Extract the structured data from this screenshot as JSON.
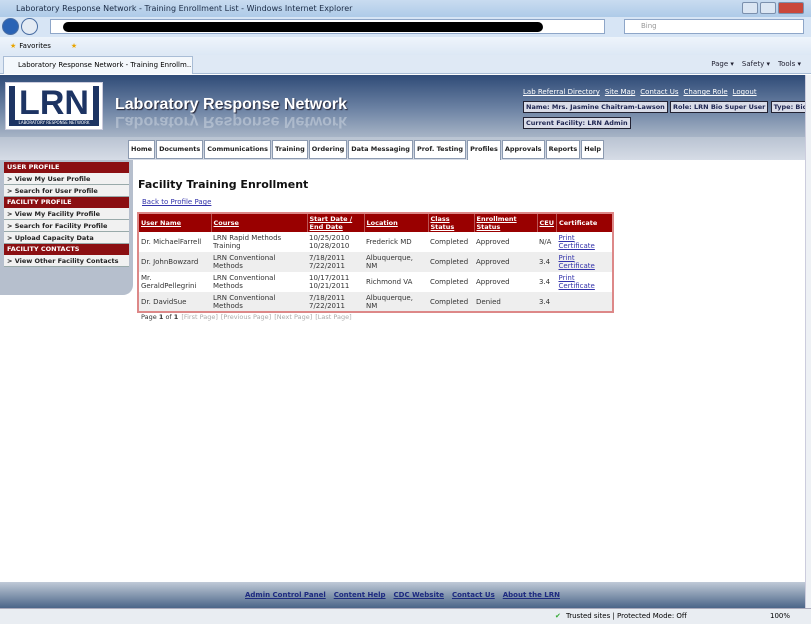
{
  "browser": {
    "window_title": "Laboratory Response Network - Training Enrollment List - Windows Internet Explorer",
    "search_placeholder": "Bing",
    "favorites_label": "Favorites",
    "tab_title": "Laboratory Response Network - Training Enrollm...",
    "commands": [
      "Page ▾",
      "Safety ▾",
      "Tools ▾"
    ],
    "status_text": "Trusted sites | Protected Mode: Off",
    "zoom": "100%"
  },
  "header": {
    "logo_text": "LRN",
    "logo_subtext": "LABORATORY RESPONSE NETWORK",
    "site_title": "Laboratory Response Network",
    "links": [
      "Lab Referral Directory",
      "Site Map",
      "Contact Us",
      "Change Role",
      "Logout"
    ],
    "name": "Name: Mrs. Jasmine Chaitram-Lawson",
    "role": "Role: LRN Bio Super User",
    "type": "Type: Bio",
    "facility": "Current Facility: LRN Admin"
  },
  "nav": [
    "Home",
    "Documents",
    "Communications",
    "Training",
    "Ordering",
    "Data Messaging",
    "Prof. Testing",
    "Profiles",
    "Approvals",
    "Reports",
    "Help"
  ],
  "sidebar": {
    "user_profile": "USER PROFILE",
    "view_user": "> View My User Profile",
    "search_user": "> Search for User Profile",
    "facility_profile": "FACILITY PROFILE",
    "view_facility": "> View My Facility Profile",
    "search_facility": "> Search for Facility Profile",
    "upload": "> Upload Capacity Data",
    "facility_contacts": "FACILITY CONTACTS",
    "view_contacts": "> View Other Facility Contacts"
  },
  "main": {
    "title": "Facility Training Enrollment",
    "back": "Back to Profile Page",
    "columns": [
      "User Name",
      "Course",
      "Start Date / End Date",
      "Location",
      "Class Status",
      "Enrollment Status",
      "CEU",
      "Certificate"
    ],
    "rows": [
      {
        "user": "Dr. MichaelFarrell",
        "course": "LRN Rapid Methods Training",
        "start": "10/25/2010",
        "end": "10/28/2010",
        "location": "Frederick MD",
        "class_status": "Completed",
        "enrollment": "Approved",
        "ceu": "N/A",
        "cert": "Print Certificate"
      },
      {
        "user": "Dr. JohnBowzard",
        "course": "LRN Conventional Methods",
        "start": "7/18/2011",
        "end": "7/22/2011",
        "location": "Albuquerque, NM",
        "class_status": "Completed",
        "enrollment": "Approved",
        "ceu": "3.4",
        "cert": "Print Certificate"
      },
      {
        "user": "Mr. GeraldPellegrini",
        "course": "LRN Conventional Methods",
        "start": "10/17/2011",
        "end": "10/21/2011",
        "location": "Richmond VA",
        "class_status": "Completed",
        "enrollment": "Approved",
        "ceu": "3.4",
        "cert": "Print Certificate"
      },
      {
        "user": "Dr. DavidSue",
        "course": "LRN Conventional Methods",
        "start": "7/18/2011",
        "end": "7/22/2011",
        "location": "Albuquerque, NM",
        "class_status": "Completed",
        "enrollment": "Denied",
        "ceu": "3.4",
        "cert": ""
      }
    ],
    "pager": {
      "page_label": "Page",
      "current": "1",
      "of": "of",
      "total": "1",
      "first": "[First Page]",
      "prev": "[Previous Page]",
      "next": "[Next Page]",
      "last": "[Last Page]"
    }
  },
  "footer": [
    "Admin Control Panel",
    "Content Help",
    "CDC Website",
    "Contact Us",
    "About the LRN"
  ]
}
